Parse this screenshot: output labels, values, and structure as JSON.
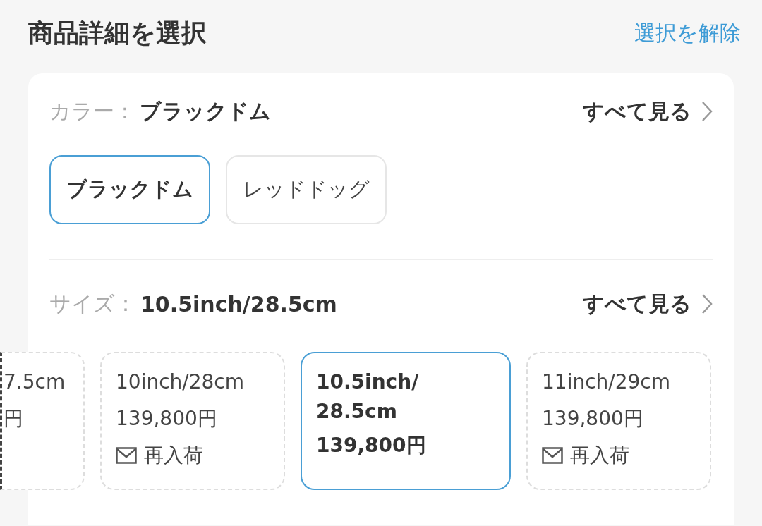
{
  "header": {
    "title": "商品詳細を選択",
    "clear_link": "選択を解除"
  },
  "color_section": {
    "label": "カラー：",
    "value": "ブラックドム",
    "see_all": "すべて見る",
    "options": [
      {
        "label": "ブラックドム",
        "selected": true
      },
      {
        "label": "レッドドッグ",
        "selected": false
      }
    ]
  },
  "size_section": {
    "label": "サイズ：",
    "value": "10.5inch/28.5cm",
    "see_all": "すべて見る",
    "options": [
      {
        "kind": "cut",
        "label_lines": [
          "7.5cm"
        ],
        "price": "円",
        "available": false,
        "selected": false
      },
      {
        "kind": "full",
        "label_lines": [
          "10inch/28cm"
        ],
        "price": "139,800円",
        "restock": "再入荷",
        "available": false,
        "selected": false
      },
      {
        "kind": "full",
        "label_lines": [
          "10.5inch/",
          "28.5cm"
        ],
        "price": "139,800円",
        "available": true,
        "selected": true
      },
      {
        "kind": "full",
        "label_lines": [
          "11inch/29cm"
        ],
        "price": "139,800円",
        "restock": "再入荷",
        "available": false,
        "selected": false
      }
    ]
  }
}
